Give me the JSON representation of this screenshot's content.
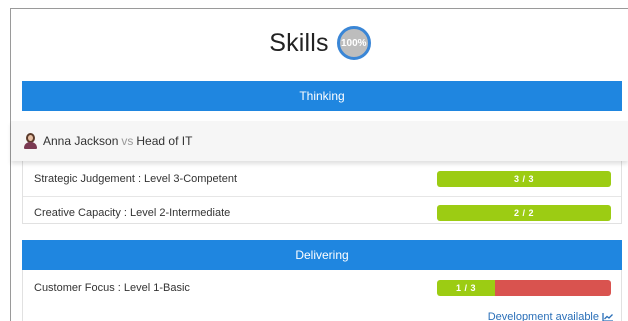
{
  "page": {
    "title": "Skills",
    "score_badge": "100%"
  },
  "user_bar": {
    "name": "Anna Jackson",
    "vs": "vs",
    "role": "Head of IT"
  },
  "sections": [
    {
      "header": "Thinking",
      "skills": [
        {
          "label": "Strategic Judgement : Level 3-Competent",
          "progress_text": "3 / 3",
          "fraction": 1.0
        },
        {
          "label": "Creative Capacity : Level 2-Intermediate",
          "progress_text": "2 / 2",
          "fraction": 1.0
        }
      ]
    },
    {
      "header": "Delivering",
      "skills": [
        {
          "label": "Customer Focus : Level 1-Basic",
          "progress_text": "1 / 3",
          "fraction": 0.3333,
          "link": "Development available"
        }
      ]
    }
  ],
  "colors": {
    "header_blue": "#1f86e0",
    "progress_green": "#9ccc13",
    "gap_red": "#d9534f",
    "link_blue": "#2a6fb8"
  }
}
